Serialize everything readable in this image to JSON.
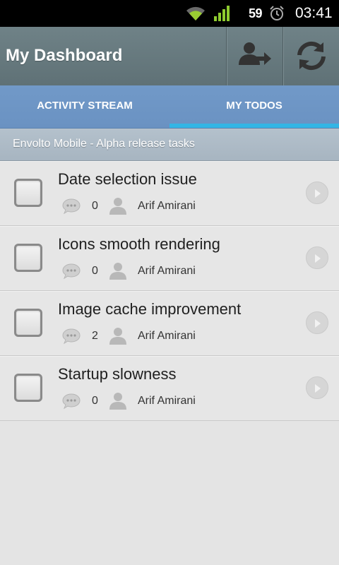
{
  "status_bar": {
    "battery": "59",
    "time": "03:41",
    "icons": [
      "wifi-icon",
      "signal-icon",
      "alarm-icon"
    ]
  },
  "action_bar": {
    "title": "My Dashboard",
    "actions": [
      "account-switch-icon",
      "refresh-icon"
    ]
  },
  "tabs": [
    {
      "label": "ACTIVITY STREAM",
      "active": false
    },
    {
      "label": "MY TODOS",
      "active": true
    }
  ],
  "section": {
    "title": "Envolto Mobile - Alpha release tasks"
  },
  "tasks": [
    {
      "title": "Date selection issue",
      "comments": "0",
      "assignee": "Arif Amirani",
      "done": false
    },
    {
      "title": "Icons smooth rendering",
      "comments": "0",
      "assignee": "Arif Amirani",
      "done": false
    },
    {
      "title": "Image cache improvement",
      "comments": "2",
      "assignee": "Arif Amirani",
      "done": false
    },
    {
      "title": "Startup slowness",
      "comments": "0",
      "assignee": "Arif Amirani",
      "done": false
    }
  ],
  "colors": {
    "action_bar": "#637579",
    "tabs": "#6e96c5",
    "tab_indicator": "#33b5e5",
    "section_header": "#adbbc7",
    "list_background": "#e4e4e4"
  }
}
